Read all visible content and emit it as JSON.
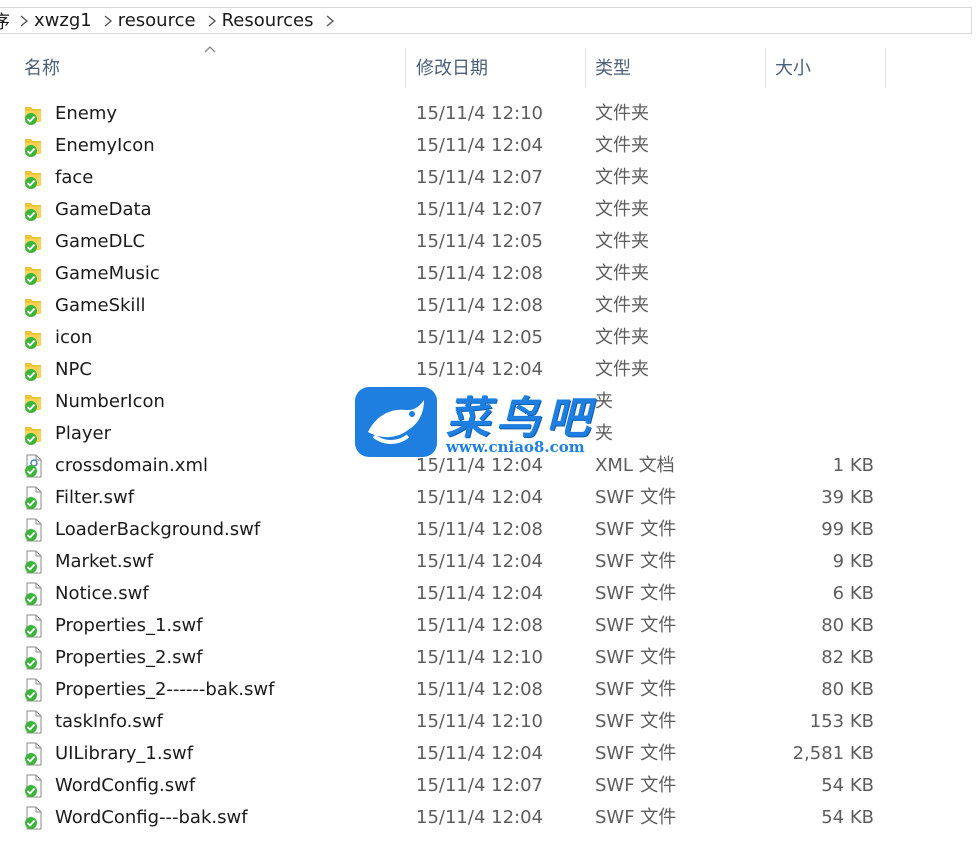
{
  "breadcrumb": [
    "序",
    "xwzg1",
    "resource",
    "Resources"
  ],
  "columns": {
    "name": "名称",
    "date": "修改日期",
    "type": "类型",
    "size": "大小"
  },
  "watermark": {
    "title": "菜鸟吧",
    "url": "www.cniao8.com"
  },
  "colors": {
    "folder": "#f0c43a",
    "check": "#3cb43c",
    "brand": "#1e7fe0"
  },
  "files": [
    {
      "name": "Enemy",
      "date": "15/11/4 12:10",
      "type": "文件夹",
      "size": "",
      "icon": "folder-icon"
    },
    {
      "name": "EnemyIcon",
      "date": "15/11/4 12:04",
      "type": "文件夹",
      "size": "",
      "icon": "folder-icon"
    },
    {
      "name": "face",
      "date": "15/11/4 12:07",
      "type": "文件夹",
      "size": "",
      "icon": "folder-icon"
    },
    {
      "name": "GameData",
      "date": "15/11/4 12:07",
      "type": "文件夹",
      "size": "",
      "icon": "folder-icon"
    },
    {
      "name": "GameDLC",
      "date": "15/11/4 12:05",
      "type": "文件夹",
      "size": "",
      "icon": "folder-icon"
    },
    {
      "name": "GameMusic",
      "date": "15/11/4 12:08",
      "type": "文件夹",
      "size": "",
      "icon": "folder-icon"
    },
    {
      "name": "GameSkill",
      "date": "15/11/4 12:08",
      "type": "文件夹",
      "size": "",
      "icon": "folder-icon"
    },
    {
      "name": "icon",
      "date": "15/11/4 12:05",
      "type": "文件夹",
      "size": "",
      "icon": "folder-icon"
    },
    {
      "name": "NPC",
      "date": "15/11/4 12:04",
      "type": "文件夹",
      "size": "",
      "icon": "folder-icon"
    },
    {
      "name": "NumberIcon",
      "date": "",
      "type": "夹",
      "size": "",
      "icon": "folder-icon"
    },
    {
      "name": "Player",
      "date": "",
      "type": "夹",
      "size": "",
      "icon": "folder-icon"
    },
    {
      "name": "crossdomain.xml",
      "date": "15/11/4 12:04",
      "type": "XML 文档",
      "size": "1 KB",
      "icon": "xml-file-icon"
    },
    {
      "name": "Filter.swf",
      "date": "15/11/4 12:04",
      "type": "SWF 文件",
      "size": "39 KB",
      "icon": "swf-file-icon"
    },
    {
      "name": "LoaderBackground.swf",
      "date": "15/11/4 12:08",
      "type": "SWF 文件",
      "size": "99 KB",
      "icon": "swf-file-icon"
    },
    {
      "name": "Market.swf",
      "date": "15/11/4 12:04",
      "type": "SWF 文件",
      "size": "9 KB",
      "icon": "swf-file-icon"
    },
    {
      "name": "Notice.swf",
      "date": "15/11/4 12:04",
      "type": "SWF 文件",
      "size": "6 KB",
      "icon": "swf-file-icon"
    },
    {
      "name": "Properties_1.swf",
      "date": "15/11/4 12:08",
      "type": "SWF 文件",
      "size": "80 KB",
      "icon": "swf-file-icon"
    },
    {
      "name": "Properties_2.swf",
      "date": "15/11/4 12:10",
      "type": "SWF 文件",
      "size": "82 KB",
      "icon": "swf-file-icon"
    },
    {
      "name": "Properties_2------bak.swf",
      "date": "15/11/4 12:08",
      "type": "SWF 文件",
      "size": "80 KB",
      "icon": "swf-file-icon"
    },
    {
      "name": "taskInfo.swf",
      "date": "15/11/4 12:10",
      "type": "SWF 文件",
      "size": "153 KB",
      "icon": "swf-file-icon"
    },
    {
      "name": "UILibrary_1.swf",
      "date": "15/11/4 12:04",
      "type": "SWF 文件",
      "size": "2,581 KB",
      "icon": "swf-file-icon"
    },
    {
      "name": "WordConfig.swf",
      "date": "15/11/4 12:07",
      "type": "SWF 文件",
      "size": "54 KB",
      "icon": "swf-file-icon"
    },
    {
      "name": "WordConfig---bak.swf",
      "date": "15/11/4 12:04",
      "type": "SWF 文件",
      "size": "54 KB",
      "icon": "swf-file-icon"
    }
  ]
}
